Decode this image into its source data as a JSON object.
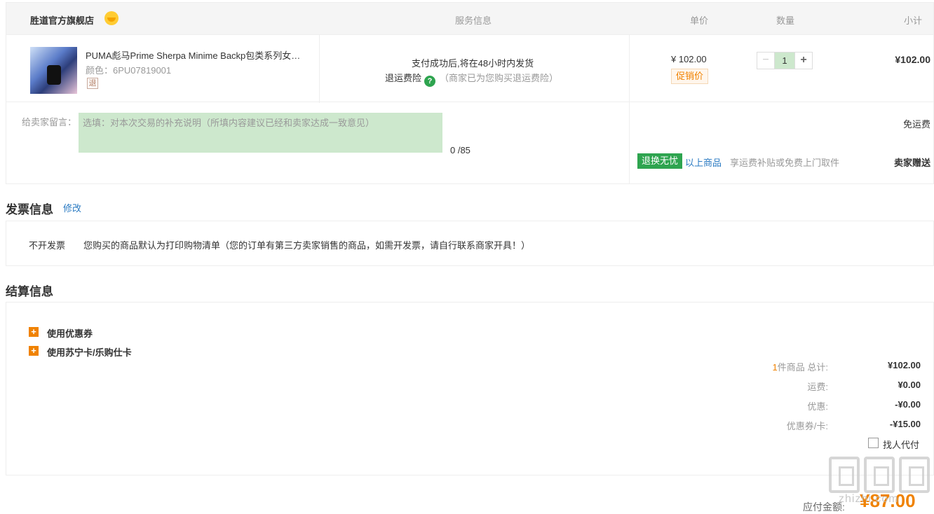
{
  "header": {
    "store_name": "胜道官方旗舰店",
    "col_service": "服务信息",
    "col_unit_price": "单价",
    "col_quantity": "数量",
    "col_subtotal": "小计"
  },
  "product": {
    "title": "PUMA彪马Prime Sherpa Minime Backp包类系列女…",
    "color": "颜色：6PU07819001",
    "return_tag": "退",
    "service_line1": "支付成功后,将在48小时内发货",
    "service_line2_label": "退运费险",
    "service_help": "?",
    "service_line2_note": "（商家已为您购买退运费险）",
    "unit_price": "¥ 102.00",
    "promo_tag": "促销价",
    "qty_minus": "−",
    "quantity": "1",
    "qty_plus": "+",
    "subtotal": "¥102.00"
  },
  "message": {
    "label": "给卖家留言：",
    "placeholder": "选填：对本次交易的补充说明（所填内容建议已经和卖家达成一致意见）",
    "count": "0 /85",
    "shipping": "免运费",
    "return_badge": "退换无忧",
    "above_items_link": "以上商品",
    "return_note": "享运费补贴或免费上门取件",
    "seller_gift": "卖家赠送"
  },
  "invoice": {
    "title": "发票信息",
    "edit_link": "修改",
    "type": "不开发票",
    "note": "您购买的商品默认为打印购物清单（您的订单有第三方卖家销售的商品，如需开发票，请自行联系商家开具！）"
  },
  "settlement": {
    "title": "结算信息",
    "option_coupon": "使用优惠券",
    "option_card": "使用苏宁卡/乐购仕卡",
    "item_count": "1",
    "total_label": "件商品 总计:",
    "total_value": "¥102.00",
    "shipping_label": "运费:",
    "shipping_value": "¥0.00",
    "discount_label": "优惠:",
    "discount_value": "-¥0.00",
    "coupon_label": "优惠券/卡:",
    "coupon_value": "-¥15.00",
    "proxy_pay_label": "找人代付",
    "pay_label": "应付金额:",
    "pay_value": "¥87.00"
  },
  "watermark": {
    "site": "zhizhi.com"
  }
}
